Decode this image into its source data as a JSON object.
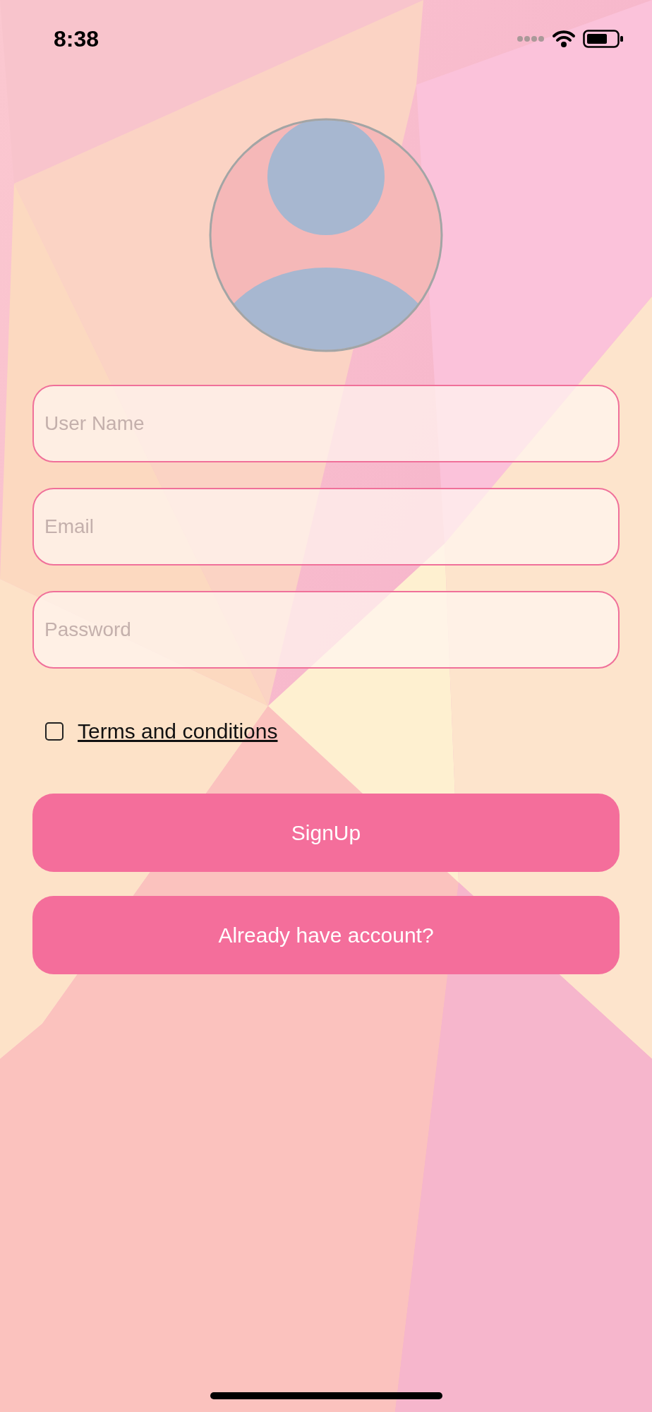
{
  "status_bar": {
    "time": "8:38"
  },
  "fields": [
    {
      "placeholder": "User Name"
    },
    {
      "placeholder": "Email"
    },
    {
      "placeholder": "Password"
    }
  ],
  "terms": {
    "label": "Terms and conditions",
    "checked": false
  },
  "buttons": [
    {
      "label": "SignUp"
    },
    {
      "label": "Already have account?"
    }
  ]
}
